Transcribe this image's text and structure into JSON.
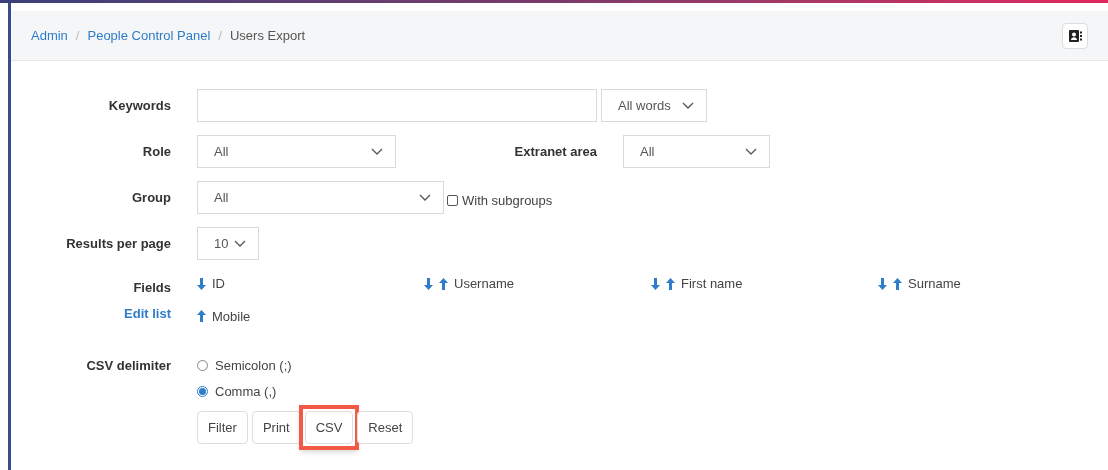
{
  "breadcrumb": [
    {
      "label": "Admin",
      "link": true
    },
    {
      "label": "People Control Panel",
      "link": true
    },
    {
      "label": "Users Export",
      "link": false
    }
  ],
  "breadcrumb_separator": "/",
  "keywords": {
    "label": "Keywords",
    "mode": "All words"
  },
  "role": {
    "label": "Role",
    "value": "All"
  },
  "extranet": {
    "label": "Extranet area",
    "value": "All"
  },
  "group": {
    "label": "Group",
    "value": "All",
    "subgroups_label": "With subgroups",
    "subgroups_checked": false
  },
  "results": {
    "label": "Results per page",
    "value": "10"
  },
  "fields": {
    "label": "Fields",
    "edit_link": "Edit list",
    "items": [
      {
        "name": "ID",
        "down": true,
        "up": false
      },
      {
        "name": "Username",
        "down": true,
        "up": true
      },
      {
        "name": "First name",
        "down": true,
        "up": true
      },
      {
        "name": "Surname",
        "down": true,
        "up": true
      },
      {
        "name": "Mobile",
        "down": false,
        "up": true
      }
    ]
  },
  "csv_delimiter": {
    "label": "CSV delimiter",
    "options": [
      {
        "label": "Semicolon (;)",
        "selected": false
      },
      {
        "label": "Comma (,)",
        "selected": true
      }
    ]
  },
  "buttons": [
    {
      "label": "Filter",
      "highlighted": false
    },
    {
      "label": "Print",
      "highlighted": false
    },
    {
      "label": "CSV",
      "highlighted": true
    },
    {
      "label": "Reset",
      "highlighted": false
    }
  ]
}
